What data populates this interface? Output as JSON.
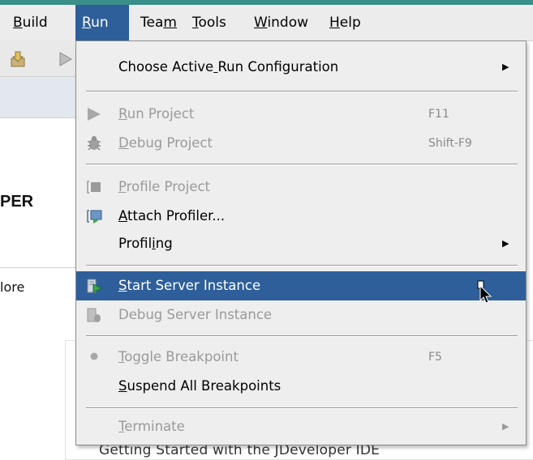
{
  "menubar": {
    "items": [
      {
        "label": "Build",
        "mnemonic_index": 0
      },
      {
        "label": "Run",
        "mnemonic_index": 0
      },
      {
        "label": "Team",
        "mnemonic_index": 3
      },
      {
        "label": "Tools",
        "mnemonic_index": 0
      },
      {
        "label": "Window",
        "mnemonic_index": 0
      },
      {
        "label": "Help",
        "mnemonic_index": 0
      }
    ],
    "active": "Run"
  },
  "background": {
    "fragment_per": "PER",
    "fragment_more": "lore",
    "fragment_getting": "Getting Started with the JDeveloper IDE"
  },
  "run_menu": {
    "choose_active": {
      "label": "Choose Active Run Configuration",
      "submenu": true
    },
    "run_project": {
      "label": "Run Project",
      "accel": "F11",
      "enabled": false
    },
    "debug_project": {
      "label": "Debug Project",
      "accel": "Shift-F9",
      "enabled": false
    },
    "profile_project": {
      "label": "Profile Project",
      "enabled": false
    },
    "attach_profiler": {
      "label": "Attach Profiler...",
      "enabled": true
    },
    "profiling": {
      "label": "Profiling",
      "submenu": true
    },
    "start_server": {
      "label": "Start Server Instance",
      "enabled": true,
      "highlighted": true
    },
    "debug_server": {
      "label": "Debug Server Instance",
      "enabled": false
    },
    "toggle_breakpoint": {
      "label": "Toggle Breakpoint",
      "accel": "F5",
      "enabled": false
    },
    "suspend_breakpoints": {
      "label": "Suspend All Breakpoints",
      "enabled": true
    },
    "terminate": {
      "label": "Terminate",
      "submenu": true,
      "enabled": false
    }
  },
  "colors": {
    "accent": "#3a8f8a",
    "highlight": "#2e5f9a",
    "menu_bg": "#eeeeee",
    "disabled_text": "#9a9a9a"
  },
  "icons": {
    "run_project": "play-triangle-icon",
    "debug_project": "bug-icon",
    "profile_project": "profile-icon",
    "attach_profiler": "attach-profiler-icon",
    "start_server": "server-start-icon",
    "debug_server": "server-debug-icon",
    "toggle_breakpoint": "breakpoint-dot-icon"
  }
}
